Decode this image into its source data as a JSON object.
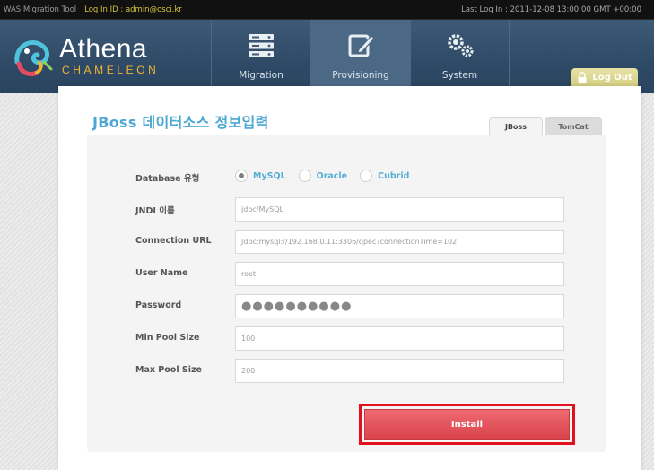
{
  "topbar": {
    "tool_name": "WAS Migration Tool",
    "login_id": "Log In ID : admin@osci.kr",
    "last_login": "Last Log In : 2011-12-08 13:00:00 GMT +00:00"
  },
  "header": {
    "logo_name": "Athena",
    "logo_sub": "CHAMELEON",
    "nav": [
      {
        "label": "Migration",
        "icon": "server-stack-icon",
        "active": false
      },
      {
        "label": "Provisioning",
        "icon": "edit-icon",
        "active": true
      },
      {
        "label": "System",
        "icon": "gears-icon",
        "active": false
      }
    ],
    "logout_label": "Log Out"
  },
  "main": {
    "title": "JBoss 데이터소스 정보입력",
    "tabs": [
      {
        "label": "JBoss",
        "active": true
      },
      {
        "label": "TomCat",
        "active": false
      }
    ],
    "form": {
      "db_type": {
        "label": "Database 유형",
        "options": [
          "MySQL",
          "Oracle",
          "Cubrid"
        ],
        "selected": "MySQL"
      },
      "jndi": {
        "label": "JNDI 이름",
        "value": "jdbc/MySQL"
      },
      "conn_url": {
        "label": "Connection URL",
        "value": "Jdbc:mysql://192.168.0.11:3306/qpec?connectionTime=102"
      },
      "user": {
        "label": "User Name",
        "value": "root"
      },
      "password": {
        "label": "Password",
        "value": "●●●●●●●●●●"
      },
      "min_pool": {
        "label": "Min Pool Size",
        "value": "100"
      },
      "max_pool": {
        "label": "Max Pool Size",
        "value": "200"
      }
    },
    "install_label": "Install"
  },
  "colors": {
    "accent": "#4aa8d3",
    "header_bg": "#2f4a66",
    "install": "#d9434c",
    "highlight": "#e3101e",
    "logout": "#d3cd7f"
  }
}
